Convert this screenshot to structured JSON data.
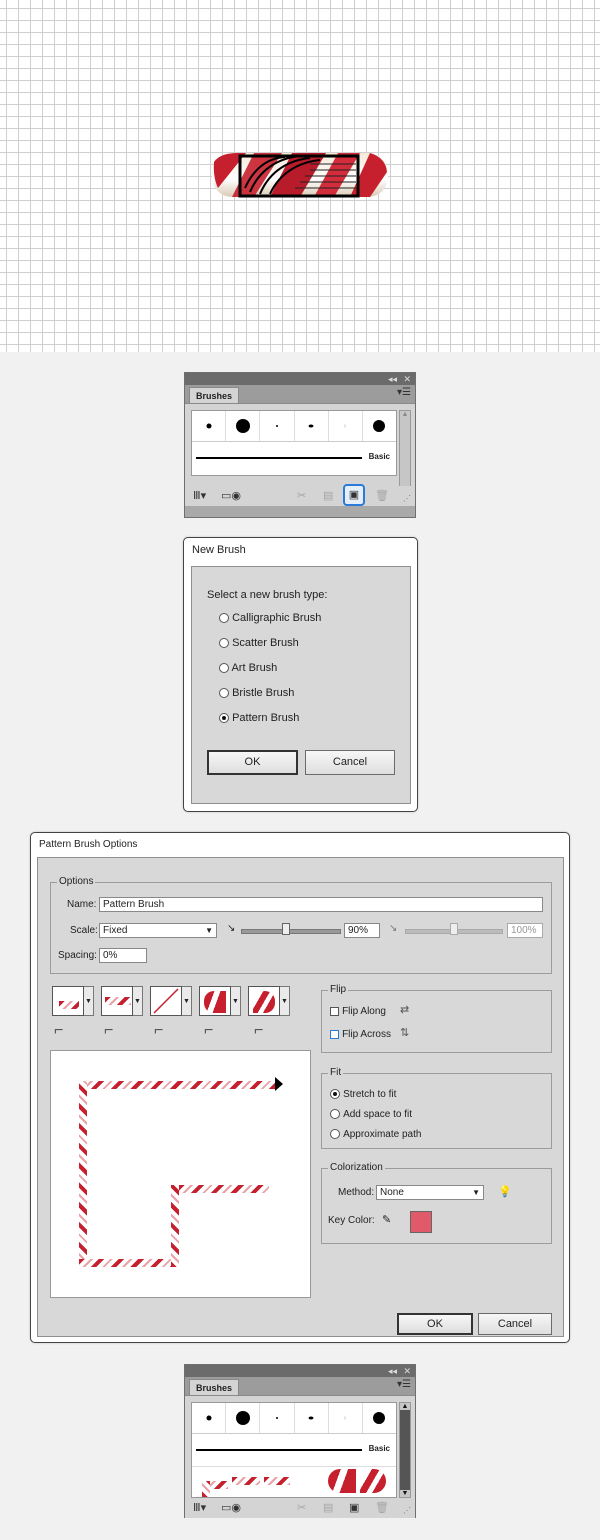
{
  "brushes_panel": {
    "tab": "Brushes",
    "basic_label": "Basic",
    "collapse_icon": "double-chevron-left-icon",
    "close_icon": "close-icon",
    "menu_icon": "panel-menu-icon"
  },
  "new_brush_dialog": {
    "title": "New Brush",
    "prompt": "Select a new brush type:",
    "options": [
      "Calligraphic Brush",
      "Scatter Brush",
      "Art Brush",
      "Bristle Brush",
      "Pattern Brush"
    ],
    "selected": "Pattern Brush",
    "ok": "OK",
    "cancel": "Cancel"
  },
  "pattern_dialog": {
    "title": "Pattern Brush Options",
    "options_group": "Options",
    "name_label": "Name:",
    "name_value": "Pattern Brush",
    "scale_label": "Scale:",
    "scale_value": "Fixed",
    "scale_pct": "90%",
    "scale_pct2": "100%",
    "spacing_label": "Spacing:",
    "spacing_value": "0%",
    "flip_group": "Flip",
    "flip_along": "Flip Along",
    "flip_across": "Flip Across",
    "fit_group": "Fit",
    "fit_options": [
      "Stretch to fit",
      "Add space to fit",
      "Approximate path"
    ],
    "fit_selected": "Stretch to fit",
    "color_group": "Colorization",
    "method_label": "Method:",
    "method_value": "None",
    "key_label": "Key Color:",
    "key_color": "#e05a6a",
    "ok": "OK",
    "cancel": "Cancel"
  },
  "colors": {
    "candy_red": "#c6202e",
    "highlight_blue": "#2a7ad9"
  }
}
